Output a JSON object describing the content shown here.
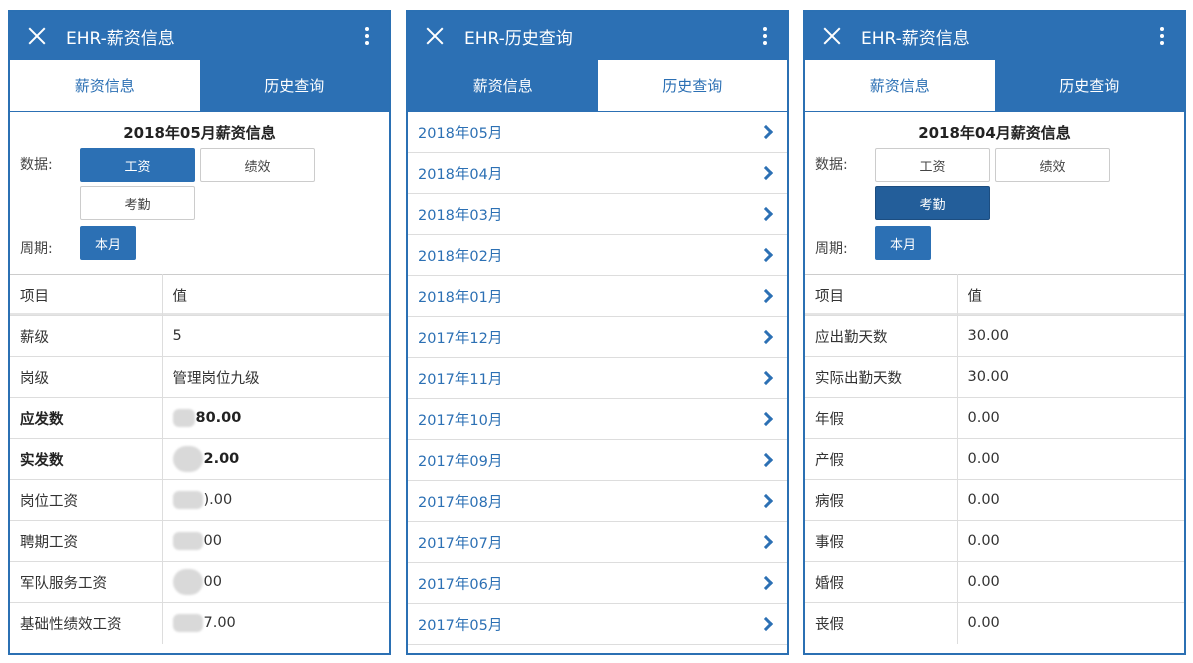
{
  "panel1": {
    "title": "EHR-薪资信息",
    "tabs": [
      "薪资信息",
      "历史查询"
    ],
    "heading": "2018年05月薪资信息",
    "data_label": "数据:",
    "buttons": [
      "工资",
      "绩效",
      "考勤"
    ],
    "period_label": "周期:",
    "period_button": "本月",
    "table_header": [
      "项目",
      "值"
    ],
    "rows": [
      {
        "item": "薪级",
        "value": "5"
      },
      {
        "item": "岗级",
        "value": "管理岗位九级"
      },
      {
        "item": "应发数",
        "value": "80.00"
      },
      {
        "item": "实发数",
        "value": "2.00"
      },
      {
        "item": "岗位工资",
        "value": ").00"
      },
      {
        "item": "聘期工资",
        "value": "00"
      },
      {
        "item": "军队服务工资",
        "value": "00"
      },
      {
        "item": "基础性绩效工资",
        "value": "7.00"
      }
    ]
  },
  "panel2": {
    "title": "EHR-历史查询",
    "tabs": [
      "薪资信息",
      "历史查询"
    ],
    "months": [
      "2018年05月",
      "2018年04月",
      "2018年03月",
      "2018年02月",
      "2018年01月",
      "2017年12月",
      "2017年11月",
      "2017年10月",
      "2017年09月",
      "2017年08月",
      "2017年07月",
      "2017年06月",
      "2017年05月"
    ]
  },
  "panel3": {
    "title": "EHR-薪资信息",
    "tabs": [
      "薪资信息",
      "历史查询"
    ],
    "heading": "2018年04月薪资信息",
    "data_label": "数据:",
    "buttons": [
      "工资",
      "绩效",
      "考勤"
    ],
    "period_label": "周期:",
    "period_button": "本月",
    "table_header": [
      "项目",
      "值"
    ],
    "rows": [
      {
        "item": "应出勤天数",
        "value": "30.00"
      },
      {
        "item": "实际出勤天数",
        "value": "30.00"
      },
      {
        "item": "年假",
        "value": "0.00"
      },
      {
        "item": "产假",
        "value": "0.00"
      },
      {
        "item": "病假",
        "value": "0.00"
      },
      {
        "item": "事假",
        "value": "0.00"
      },
      {
        "item": "婚假",
        "value": "0.00"
      },
      {
        "item": "丧假",
        "value": "0.00"
      }
    ]
  },
  "colors": {
    "primary": "#2c70b4",
    "pressed": "#235e9a"
  },
  "icons": {
    "close": "close-icon",
    "menu": "more-vertical-icon",
    "chevron": "chevron-right-icon"
  }
}
